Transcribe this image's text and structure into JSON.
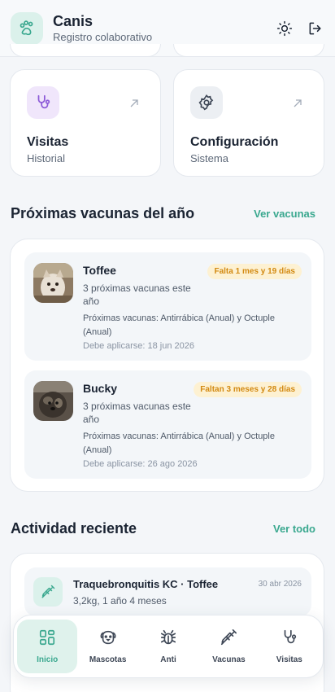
{
  "header": {
    "title": "Canis",
    "subtitle": "Registro colaborativo",
    "logo_icon": "paw-icon",
    "actions": [
      "sun-icon",
      "logout-icon"
    ]
  },
  "tiles": [
    {
      "title": "Visitas",
      "subtitle": "Historial",
      "icon": "stethoscope-icon",
      "accent": "#8c5ad8"
    },
    {
      "title": "Configuración",
      "subtitle": "Sistema",
      "icon": "gear-icon",
      "accent": "#3e4756"
    }
  ],
  "vaccines": {
    "title": "Próximas vacunas del año",
    "link": "Ver vacunas",
    "items": [
      {
        "name": "Toffee",
        "badge": "Falta 1 mes y 19 días",
        "count": "3 próximas vacunas este año",
        "next": "Próximas vacunas: Antirrábica (Anual) y Octuple (Anual)",
        "due": "Debe aplicarse: 18 jun 2026"
      },
      {
        "name": "Bucky",
        "badge": "Faltan 3 meses y 28 días",
        "count": "3 próximas vacunas este año",
        "next": "Próximas vacunas: Antirrábica (Anual) y Octuple (Anual)",
        "due": "Debe aplicarse: 26 ago 2026"
      }
    ]
  },
  "activity": {
    "title": "Actividad reciente",
    "link": "Ver todo",
    "items": [
      {
        "title": "Traquebronquitis KC · Toffee",
        "subtitle": "3,2kg, 1 año 4 meses",
        "date": "30 abr 2026",
        "icon": "syringe-icon"
      }
    ]
  },
  "nav": {
    "items": [
      {
        "label": "Inicio",
        "icon": "home-grid-icon",
        "active": true
      },
      {
        "label": "Mascotas",
        "icon": "dog-icon",
        "active": false
      },
      {
        "label": "Anti",
        "icon": "bug-icon",
        "active": false
      },
      {
        "label": "Vacunas",
        "icon": "syringe-icon",
        "active": false
      },
      {
        "label": "Visitas",
        "icon": "stethoscope-icon",
        "active": false
      }
    ]
  },
  "colors": {
    "accent": "#3aa88f",
    "badge_bg": "#fdf1d2",
    "badge_text": "#d38a12"
  }
}
